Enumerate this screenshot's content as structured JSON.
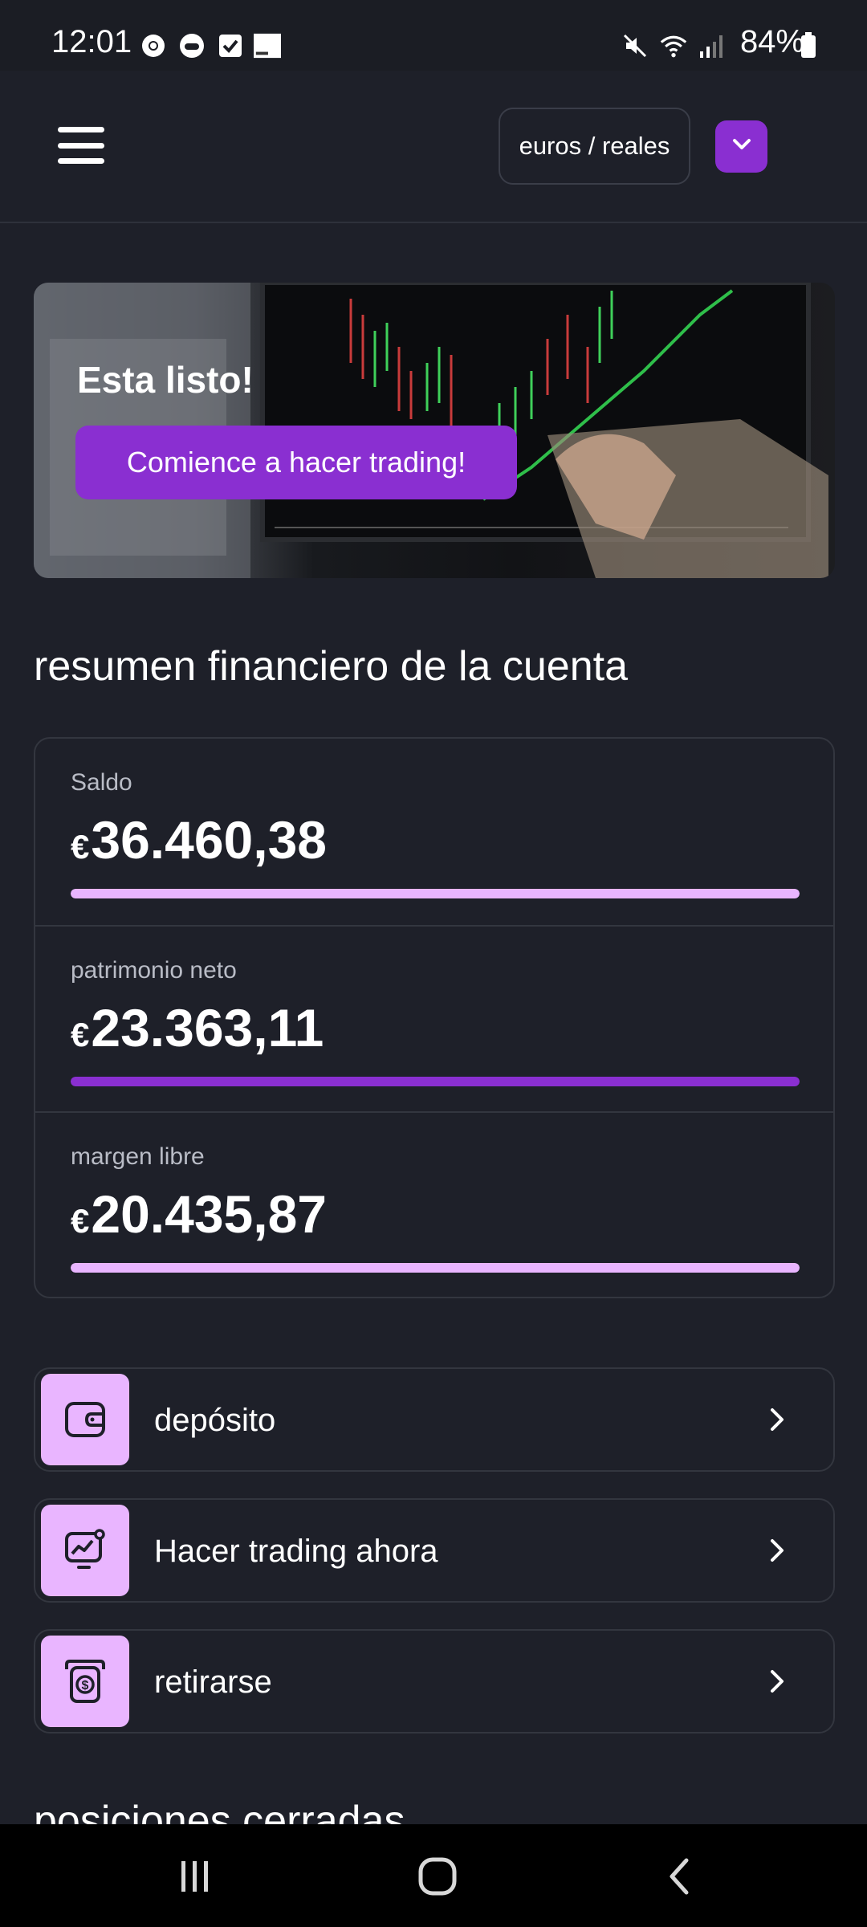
{
  "status_bar": {
    "time": "12:01",
    "battery": "84%",
    "left_icons": [
      "chrome-icon",
      "game-controller-icon",
      "checkbox-notification-icon",
      "orange-app-icon"
    ],
    "right_icons": [
      "mute-icon",
      "wifi-icon",
      "signal-icon",
      "battery-icon"
    ]
  },
  "header": {
    "menu_icon": "hamburger-menu-icon",
    "account_selector": "euros / reales",
    "dropdown_icon": "chevron-down-icon",
    "accent": "#8a2fd1"
  },
  "banner": {
    "title": "Esta listo!",
    "cta": "Comience a hacer trading!"
  },
  "summary": {
    "title": "resumen financiero de la cuenta",
    "metrics": [
      {
        "label": "Saldo",
        "currency": "€",
        "amount": "36.460,38",
        "bar_fill": 1.0,
        "bar_color": "#e9b5ff"
      },
      {
        "label": "patrimonio neto",
        "currency": "€",
        "amount": "23.363,11",
        "bar_fill": 1.0,
        "bar_color": "#8a2fd1"
      },
      {
        "label": "margen libre",
        "currency": "€",
        "amount": "20.435,87",
        "bar_fill": 1.0,
        "bar_color": "#e9b5ff"
      }
    ]
  },
  "actions": [
    {
      "label": "depósito",
      "icon": "wallet-icon"
    },
    {
      "label": "Hacer trading ahora",
      "icon": "trading-chart-icon"
    },
    {
      "label": "retirarse",
      "icon": "withdraw-dollar-icon"
    }
  ],
  "next_section_title": "posiciones cerradas",
  "nav": [
    "recent-apps-icon",
    "home-icon",
    "back-icon"
  ]
}
